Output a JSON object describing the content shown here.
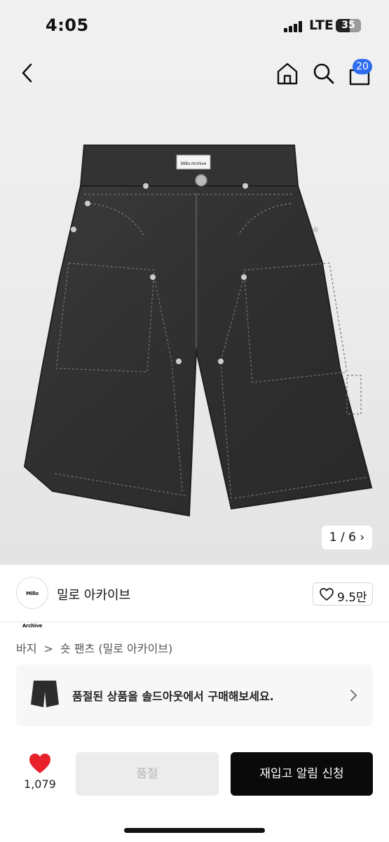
{
  "status_bar": {
    "time": "4:05",
    "network": "LTE",
    "battery": "35"
  },
  "nav": {
    "cart_count": "20"
  },
  "image": {
    "brand_label": "Millo Archive",
    "pager": "1 / 6"
  },
  "brand": {
    "logo_text": "Millo Archive",
    "name": "밀로 아카이브",
    "likes": "9.5만"
  },
  "breadcrumb": {
    "category": "바지",
    "separator": ">",
    "subcategory": "숏 팬츠 (밀로 아카이브)"
  },
  "soldout_banner": {
    "text": "품절된 상품을 솔드아웃에서 구매해보세요."
  },
  "bottom": {
    "wish_count": "1,079",
    "sold_label": "품절",
    "notify_label": "재입고 알림 신청"
  },
  "colors": {
    "accent": "#2d6cf0",
    "heart": "#e8212b",
    "primary_button": "#0a0a0a",
    "disabled_button": "#ececec"
  }
}
